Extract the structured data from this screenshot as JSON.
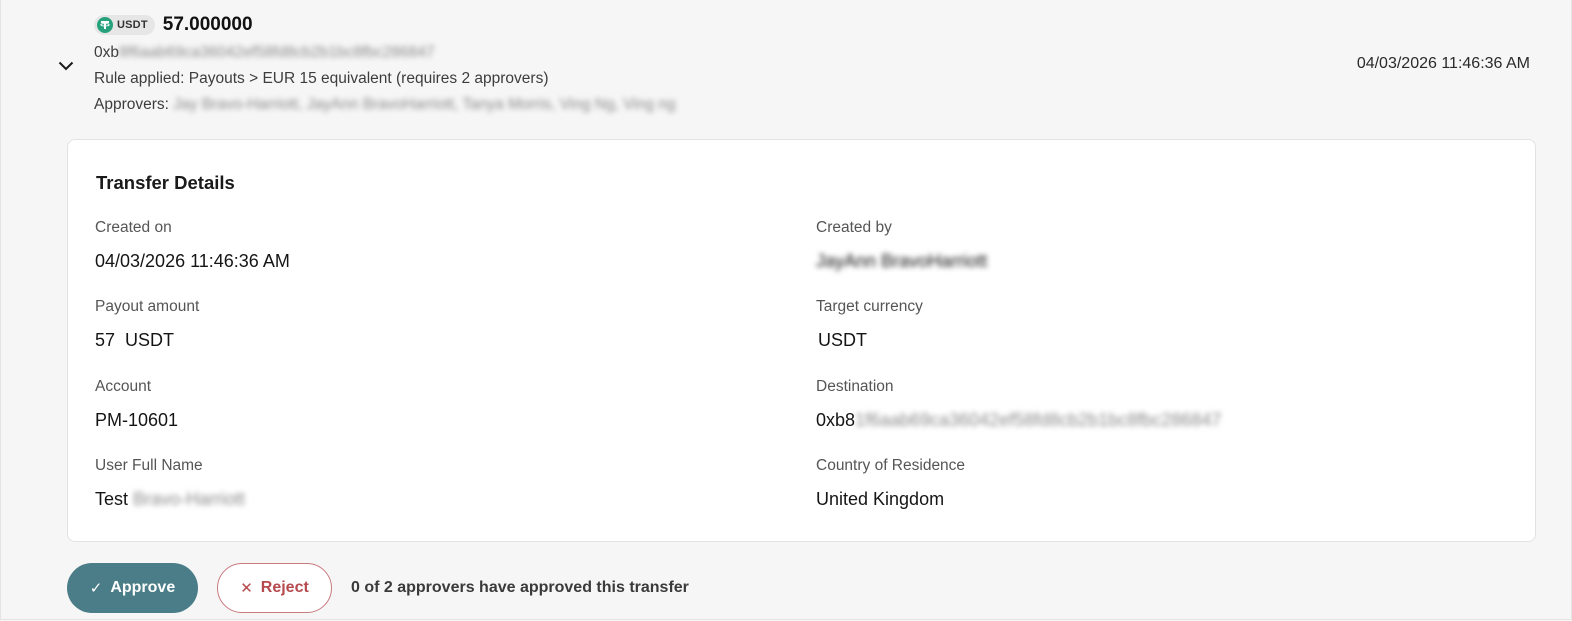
{
  "transfer": {
    "token_symbol": "USDT",
    "token_icon": "tether-icon",
    "amount": "57.000000",
    "address_prefix": "0xb",
    "address_hidden": "8f6aab69ca36042ef58fd8cb2b1bc8fbc286847",
    "rule_text": "Rule applied: Payouts > EUR 15 equivalent (requires 2 approvers)",
    "approvers_label": "Approvers:",
    "approvers_hidden": "Jay Bravo-Harriott, JayAnn BravoHarriott, Tanya Morris, Ving Ng, Ving ng",
    "timestamp": "04/03/2026 11:46:36 AM"
  },
  "details": {
    "title": "Transfer Details",
    "created_on_label": "Created on",
    "created_on_value": "04/03/2026 11:46:36 AM",
    "created_by_label": "Created by",
    "created_by_value": "JayAnn BravoHarriott",
    "payout_amount_label": "Payout amount",
    "payout_amount_value": "57  USDT",
    "target_currency_label": "Target currency",
    "target_currency_value": "USDT",
    "account_label": "Account",
    "account_value": "PM-10601",
    "destination_label": "Destination",
    "destination_prefix": "0xb8",
    "destination_hidden": "1f6aab69ca36042ef58fd8cb2b1bc8fbc286847",
    "user_full_name_label": "User Full Name",
    "user_first_name": "Test",
    "user_last_name_hidden": "Bravo-Harriott",
    "country_label": "Country of Residence",
    "country_value": "United Kingdom"
  },
  "actions": {
    "approve_icon": "✓",
    "approve_label": "Approve",
    "reject_icon": "✕",
    "reject_label": "Reject",
    "approval_status": "0 of 2 approvers have approved this transfer"
  },
  "colors": {
    "approve_bg": "#4a7d87",
    "reject_text": "#b54a4f",
    "tether_green": "#26a17b"
  }
}
